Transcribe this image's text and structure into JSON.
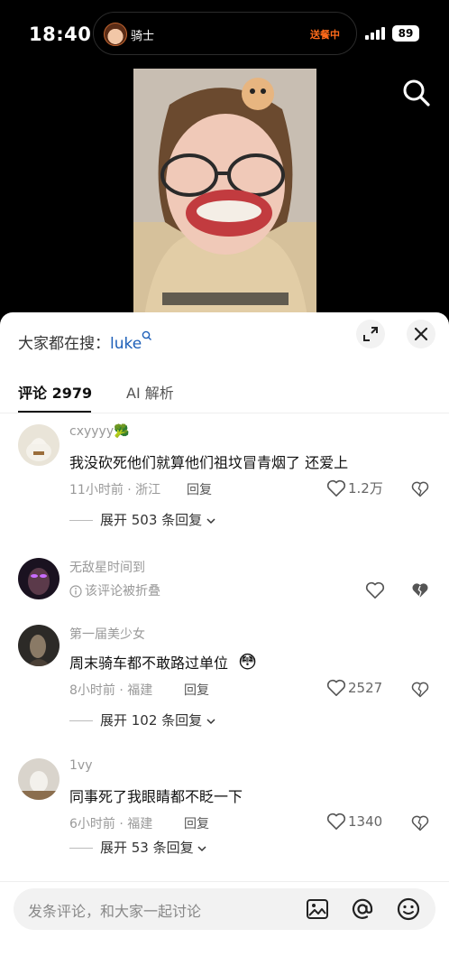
{
  "status_bar": {
    "time": "18:40",
    "island_name": "骑士",
    "island_status": "送餐中",
    "battery": "89"
  },
  "search_hint": {
    "prefix": "大家都在搜：",
    "keyword": "luke"
  },
  "tabs": {
    "comments": "评论 2979",
    "ai": "AI 解析"
  },
  "comments": [
    {
      "username": "cxyyyy🥦",
      "text": "我没砍死他们就算他们祖坟冒青烟了 还爱上",
      "meta": "11小时前 · 浙江",
      "reply": "回复",
      "likes": "1.2万",
      "expand": "展开 503 条回复"
    },
    {
      "username": "无敌星时间到",
      "collapsed_note": "该评论被折叠"
    },
    {
      "username": "第一届美少女",
      "text": "周末骑车都不敢路过单位",
      "emoji": "😳",
      "meta": "8小时前 · 福建",
      "reply": "回复",
      "likes": "2527",
      "expand": "展开 102 条回复"
    },
    {
      "username": "1vy",
      "text": "同事死了我眼睛都不眨一下",
      "meta": "6小时前 · 福建",
      "reply": "回复",
      "likes": "1340",
      "expand": "展开 53 条回复"
    }
  ],
  "input": {
    "placeholder": "发条评论，和大家一起讨论"
  },
  "icons": {
    "search": "search-icon",
    "collapse": "collapse-icon",
    "close": "close-icon",
    "like": "heart-outline-icon",
    "dislike": "broken-heart-icon",
    "image": "image-icon",
    "mention": "at-icon",
    "emoji": "emoji-icon"
  },
  "colors": {
    "accent_link": "#1d5fb8",
    "status_orange": "#ff6a1a"
  }
}
